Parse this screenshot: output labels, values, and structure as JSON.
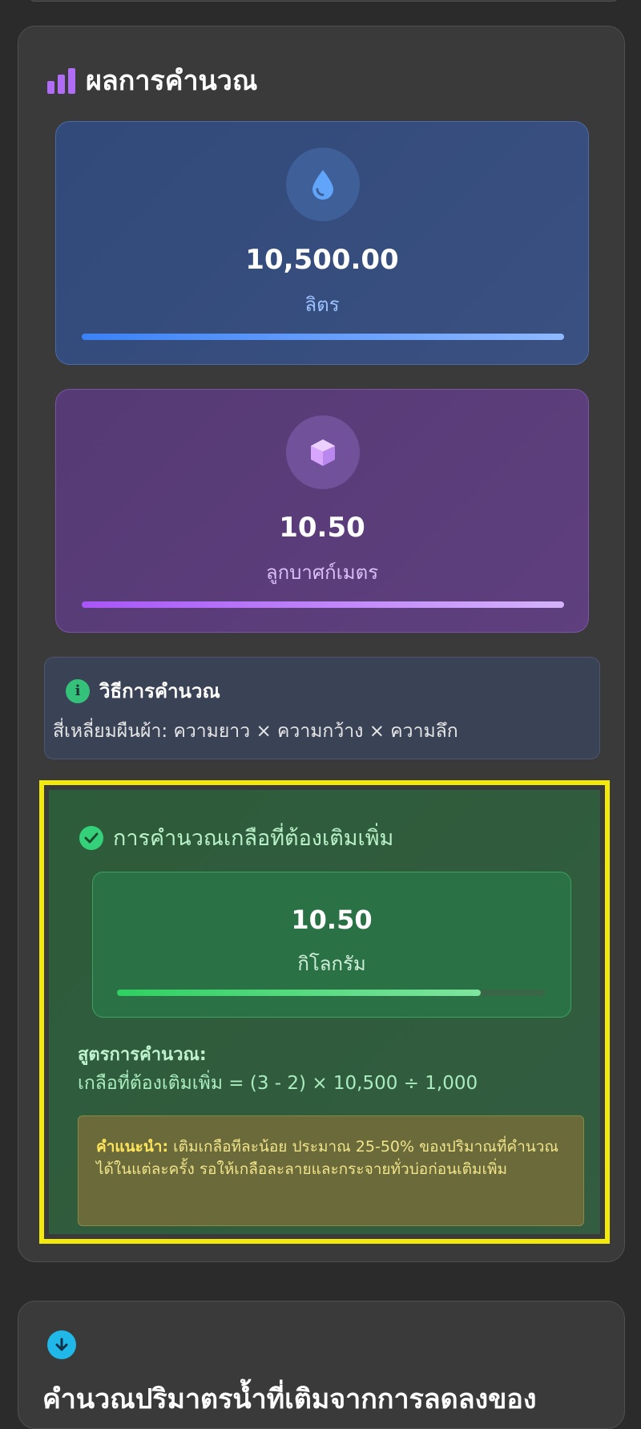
{
  "results": {
    "title": "ผลการคำนวณ",
    "icon": "bar-chart-icon",
    "water": {
      "value": "10,500.00",
      "unit": "ลิตร",
      "icon": "water-drop-icon",
      "color": "#3b82f6"
    },
    "volume": {
      "value": "10.50",
      "unit": "ลูกบาศก์เมตร",
      "icon": "cube-icon",
      "color": "#a855f7"
    },
    "method": {
      "title": "วิธีการคำนวณ",
      "text": "สี่เหลี่ยมผืนผ้า: ความยาว × ความกว้าง × ความลึก",
      "icon": "info-icon"
    },
    "salt": {
      "title": "การคำนวณเกลือที่ต้องเติมเพิ่ม",
      "icon": "check-circle-icon",
      "value": "10.50",
      "unit": "กิโลกรัม",
      "progress": 0.85,
      "formula_label": "สูตรการคำนวณ:",
      "formula": "เกลือที่ต้องเติมเพิ่ม = (3 - 2) × 10,500 ÷ 1,000",
      "tip_label": "คำแนะนำ:",
      "tip_text": " เติมเกลือทีละน้อย ประมาณ 25-50% ของปริมาณที่คำนวณได้ในแต่ละครั้ง รอให้เกลือละลายและกระจายทั่วบ่อก่อนเติมเพิ่ม",
      "color": "#34d17a"
    }
  },
  "next_section": {
    "icon": "arrow-down-circle-icon",
    "title": "คำนวณปริมาตรน้ำที่เติมจากการลดลงของ"
  },
  "highlight_color": "#f3ea0b"
}
